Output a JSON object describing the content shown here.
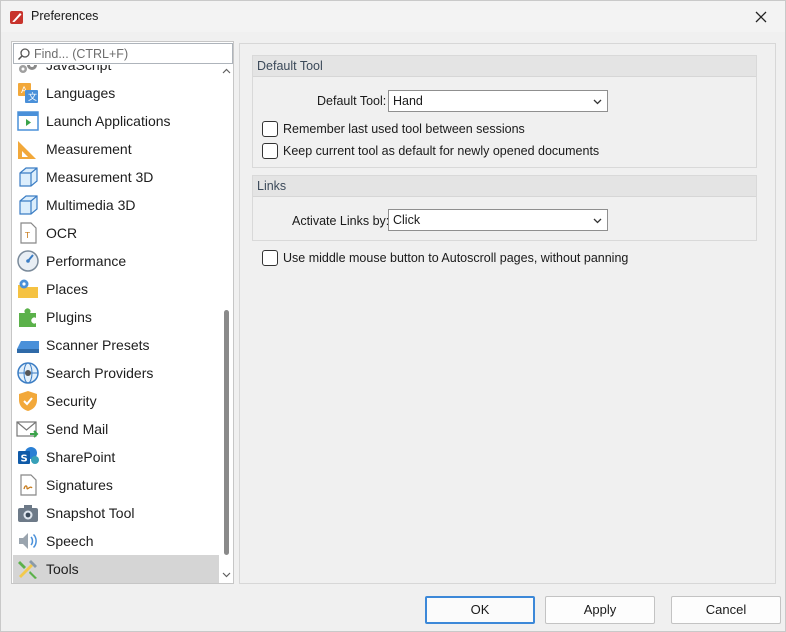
{
  "window": {
    "title": "Preferences"
  },
  "search": {
    "placeholder": "Find... (CTRL+F)"
  },
  "nav": {
    "items": [
      {
        "label": "JavaScript",
        "icon": "javascript-gear-icon"
      },
      {
        "label": "Languages",
        "icon": "languages-icon"
      },
      {
        "label": "Launch Applications",
        "icon": "launch-applications-icon"
      },
      {
        "label": "Measurement",
        "icon": "measurement-ruler-icon"
      },
      {
        "label": "Measurement 3D",
        "icon": "measurement-3d-icon"
      },
      {
        "label": "Multimedia 3D",
        "icon": "multimedia-3d-icon"
      },
      {
        "label": "OCR",
        "icon": "ocr-icon"
      },
      {
        "label": "Performance",
        "icon": "performance-gauge-icon"
      },
      {
        "label": "Places",
        "icon": "places-folder-icon"
      },
      {
        "label": "Plugins",
        "icon": "plugins-puzzle-icon"
      },
      {
        "label": "Scanner Presets",
        "icon": "scanner-icon"
      },
      {
        "label": "Search Providers",
        "icon": "search-providers-globe-icon"
      },
      {
        "label": "Security",
        "icon": "security-shield-icon"
      },
      {
        "label": "Send Mail",
        "icon": "send-mail-icon"
      },
      {
        "label": "SharePoint",
        "icon": "sharepoint-icon"
      },
      {
        "label": "Signatures",
        "icon": "signatures-icon"
      },
      {
        "label": "Snapshot Tool",
        "icon": "snapshot-camera-icon"
      },
      {
        "label": "Speech",
        "icon": "speech-speaker-icon"
      },
      {
        "label": "Tools",
        "icon": "tools-icon"
      }
    ],
    "selected": "Tools"
  },
  "default_tool_group": {
    "title": "Default Tool",
    "default_tool_label": "Default Tool:",
    "default_tool_value": "Hand",
    "remember_last_label": "Remember last used tool between sessions",
    "remember_last_checked": false,
    "keep_current_label": "Keep current tool as default for newly opened documents",
    "keep_current_checked": false
  },
  "links_group": {
    "title": "Links",
    "activate_label": "Activate Links by:",
    "activate_value": "Click"
  },
  "middle_mouse": {
    "label": "Use middle mouse button to Autoscroll pages, without panning",
    "checked": false
  },
  "buttons": {
    "ok": "OK",
    "apply": "Apply",
    "cancel": "Cancel"
  },
  "colors": {
    "accent": "#3c88d8",
    "selection": "#d5d5d5",
    "group_header": "#e4e4e4"
  }
}
